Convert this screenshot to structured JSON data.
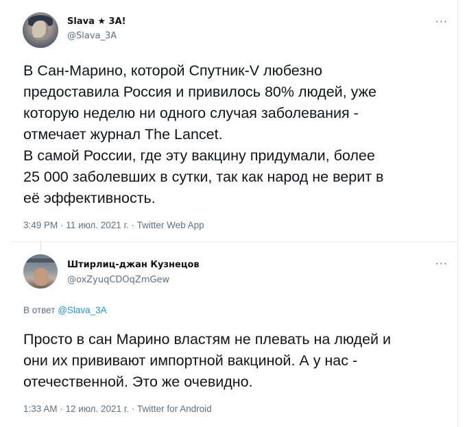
{
  "main_tweet": {
    "author_name": "Slava ★ 3A!",
    "author_handle": "@Slava_3A",
    "text": "В Сан-Марино, которой Спутник-V любезно\nпредоставила Россия и привилось 80% людей, уже\nкоторую неделю ни одного случая заболевания -\nотмечает журнал The Lancet.\nВ самой России, где эту вакцину придумали, более\n25 000 заболевших в сутки, так как народ не верит в\nеё эффективность.",
    "meta": "3:49 PM · 11 июл. 2021 г. · Twitter Web App",
    "more_icon": "more-icon"
  },
  "reply_tweet": {
    "author_name": "Штирлиц-джан Кузнецов",
    "author_handle": "@oxZyuqCDOqZmGew",
    "reply_prefix": "В ответ",
    "reply_mention": "@Slava_3A",
    "text": "Просто в сан Марино властям не плевать на людей и\nони их прививают импортной вакциной. А у нас -\nотечественной. Это же очевидно.",
    "meta": "1:33 AM · 12 июл. 2021 г. · Twitter for Android",
    "more_icon": "more-icon"
  },
  "colors": {
    "text": "#0f1419",
    "secondary": "#5b7083",
    "link": "#1b95e0",
    "border": "#e6ecf0"
  }
}
